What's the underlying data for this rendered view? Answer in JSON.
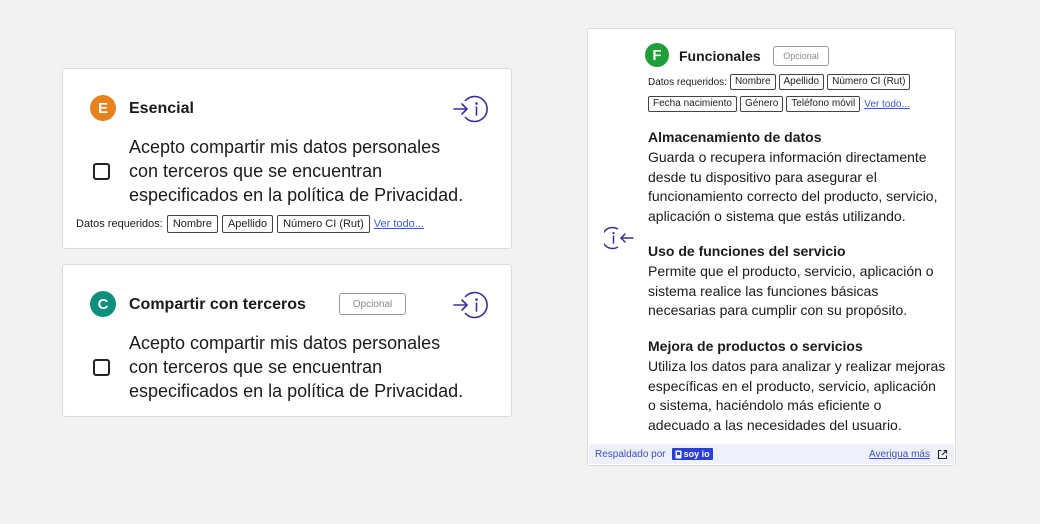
{
  "colors": {
    "esencial_badge": "#e8821e",
    "terceros_badge": "#0d8f7e",
    "funcionales_badge": "#1f9e3a",
    "accent": "#3b5bdb",
    "info_icon": "#3a2f9a"
  },
  "esencial": {
    "badge_letter": "E",
    "title": "Esencial",
    "info_icon": "info-enter-icon",
    "consent_text": "Acepto compartir mis datos personales\ncon terceros que se encuentran\nespecificados en la política de Privacidad.",
    "checked": false,
    "required_label": "Datos requeridos:",
    "chips": [
      "Nombre",
      "Apellido",
      "Número CI (Rut)"
    ],
    "see_all": "Ver todo..."
  },
  "terceros": {
    "badge_letter": "C",
    "title": "Compartir con terceros",
    "optional_label": "Opcional",
    "info_icon": "info-enter-icon",
    "consent_text": "Acepto compartir mis datos personales\ncon terceros que se encuentran\nespecificados en la política de Privacidad.",
    "checked": false
  },
  "funcionales": {
    "badge_letter": "F",
    "title": "Funcionales",
    "optional_label": "Opcional",
    "required_label": "Datos requeridos:",
    "chips_row1": [
      "Nombre",
      "Apellido",
      "Número CI (Rut)"
    ],
    "chips_row2": [
      "Fecha nacimiento",
      "Género",
      "Teléfono móvil"
    ],
    "see_all": "Ver todo...",
    "collapse_icon": "info-exit-icon",
    "sections": [
      {
        "title": "Almacenamiento de datos",
        "text": "Guarda o recupera información directamente desde tu dispositivo para asegurar el funcionamiento correcto del producto, servicio, aplicación o sistema que estás utilizando."
      },
      {
        "title": "Uso de funciones del servicio",
        "text": "Permite que el producto, servicio, aplicación o sistema realice las funciones básicas necesarias para cumplir con su propósito."
      },
      {
        "title": "Mejora de productos o servicios",
        "text": "Utiliza los datos para analizar y realizar mejoras específicas en el producto, servicio, aplicación o sistema, haciéndolo más eficiente o adecuado a las necesidades del usuario."
      }
    ],
    "footer": {
      "backed_by": "Respaldado por",
      "brand": "soy io",
      "learn_more": "Averigua más",
      "external_icon": "external-link-icon"
    }
  }
}
